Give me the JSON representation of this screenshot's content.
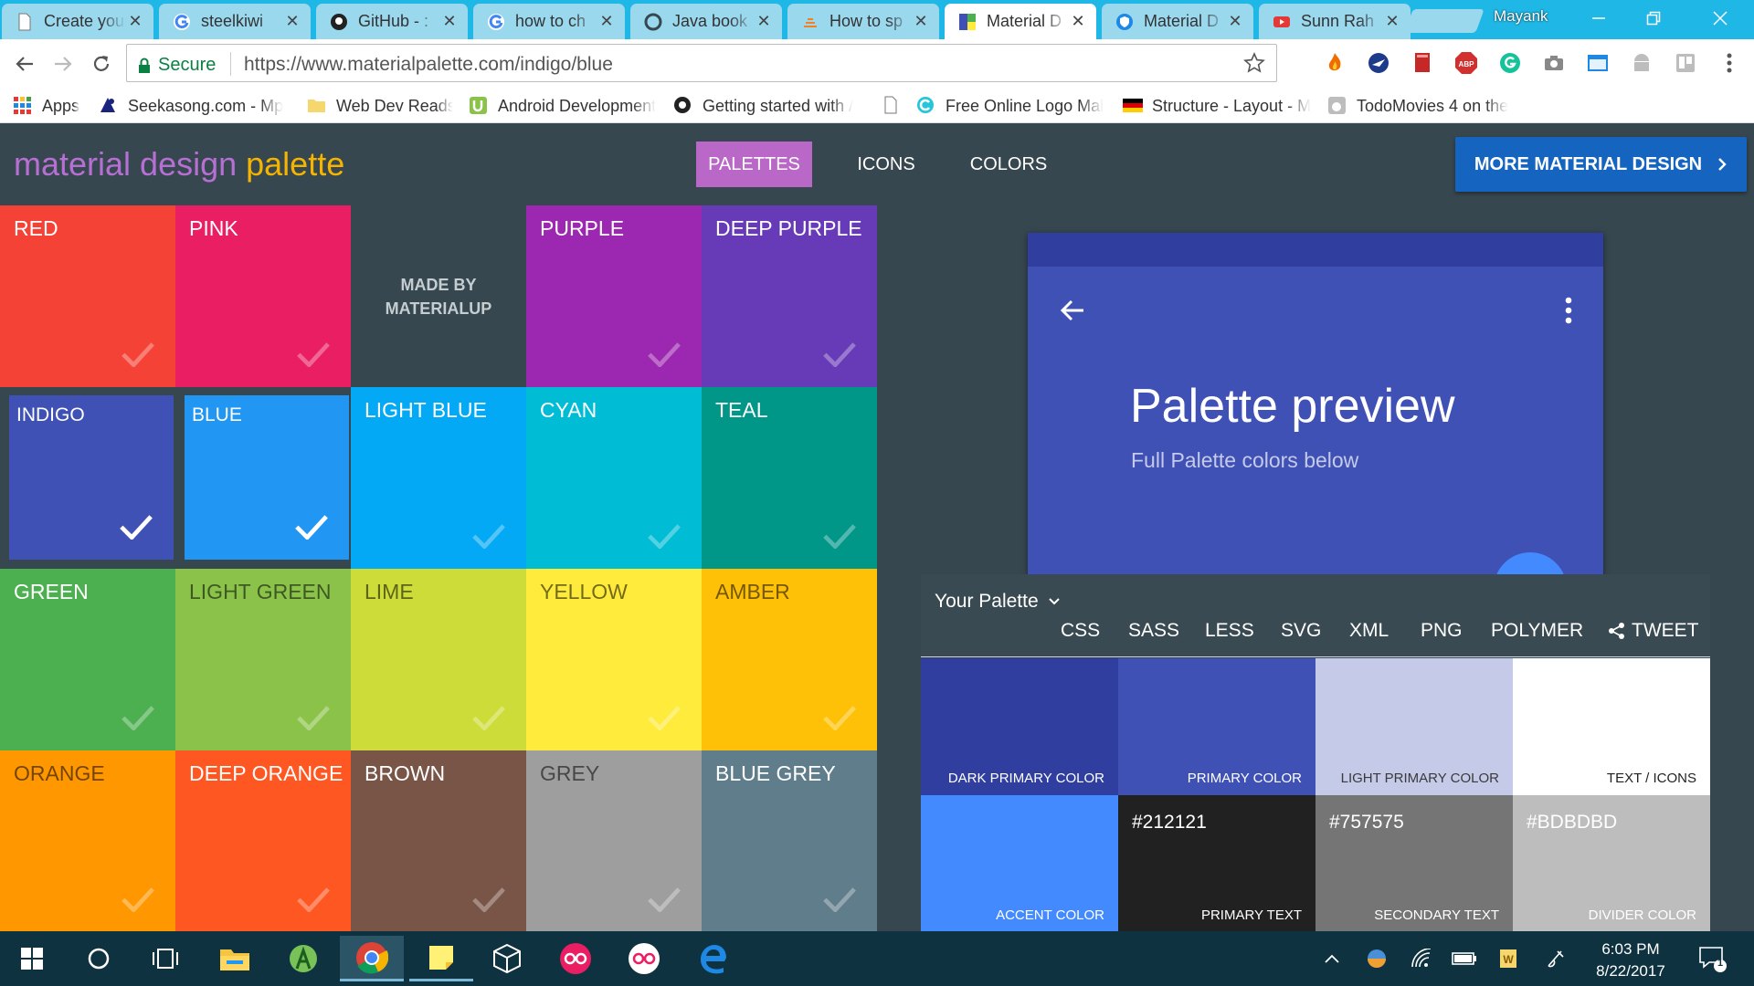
{
  "browser": {
    "tabs": [
      {
        "title": "Create your",
        "icon": "document-icon"
      },
      {
        "title": "steelkiwi",
        "icon": "google-icon"
      },
      {
        "title": "GitHub - :",
        "icon": "github-icon"
      },
      {
        "title": "how to ch",
        "icon": "google-icon"
      },
      {
        "title": "Java book",
        "icon": "circle-icon"
      },
      {
        "title": "How to sp",
        "icon": "stack-icon"
      },
      {
        "title": "Material D",
        "icon": "material-palette-icon"
      },
      {
        "title": "Material D",
        "icon": "shield-icon"
      },
      {
        "title": "Sunn Rah",
        "icon": "youtube-icon"
      }
    ],
    "active_tab": 6,
    "profile_name": "Mayank",
    "secure_label": "Secure",
    "url": "https://www.materialpalette.com/indigo/blue",
    "bookmarks": [
      {
        "label": "Apps",
        "icon": "apps-grid-icon"
      },
      {
        "label": "Seekasong.com - Mp",
        "icon": "seekasong-icon"
      },
      {
        "label": "Web Dev Reads",
        "icon": "folder-icon"
      },
      {
        "label": "Android Development",
        "icon": "udemy-icon"
      },
      {
        "label": "Getting started with /",
        "icon": "github-octocat-icon"
      },
      {
        "label": "",
        "icon": "blank-page-icon"
      },
      {
        "label": "Free Online Logo Mal",
        "icon": "logo-maker-icon"
      },
      {
        "label": "Structure - Layout - M",
        "icon": "german-flag-icon"
      },
      {
        "label": "TodoMovies 4 on the",
        "icon": "apple-icon"
      }
    ]
  },
  "site": {
    "logo_part1": "material design",
    "logo_part2": "palette",
    "nav": [
      "PALETTES",
      "ICONS",
      "COLORS"
    ],
    "more_button": "MORE MATERIAL DESIGN",
    "made_by": [
      "MADE BY",
      "MATERIALUP"
    ],
    "colors": [
      {
        "name": "RED",
        "hex": "#f44336",
        "selected": false,
        "dark_text": false
      },
      {
        "name": "PINK",
        "hex": "#e91e63",
        "selected": false,
        "dark_text": false
      },
      {
        "name": "",
        "hex": "#37474f",
        "selected": false,
        "dark_text": false
      },
      {
        "name": "PURPLE",
        "hex": "#9c27b0",
        "selected": false,
        "dark_text": false
      },
      {
        "name": "DEEP PURPLE",
        "hex": "#673ab7",
        "selected": false,
        "dark_text": false
      },
      {
        "name": "INDIGO",
        "hex": "#3f51b5",
        "selected": true,
        "dark_text": false
      },
      {
        "name": "BLUE",
        "hex": "#2196f3",
        "selected": true,
        "dark_text": false
      },
      {
        "name": "LIGHT BLUE",
        "hex": "#03a9f4",
        "selected": false,
        "dark_text": false
      },
      {
        "name": "CYAN",
        "hex": "#00bcd4",
        "selected": false,
        "dark_text": false
      },
      {
        "name": "TEAL",
        "hex": "#009688",
        "selected": false,
        "dark_text": false
      },
      {
        "name": "GREEN",
        "hex": "#4caf50",
        "selected": false,
        "dark_text": false
      },
      {
        "name": "LIGHT GREEN",
        "hex": "#8bc34a",
        "selected": false,
        "dark_text": true
      },
      {
        "name": "LIME",
        "hex": "#cddc39",
        "selected": false,
        "dark_text": true
      },
      {
        "name": "YELLOW",
        "hex": "#ffeb3b",
        "selected": false,
        "dark_text": true
      },
      {
        "name": "AMBER",
        "hex": "#ffc107",
        "selected": false,
        "dark_text": true
      },
      {
        "name": "ORANGE",
        "hex": "#ff9800",
        "selected": false,
        "dark_text": true
      },
      {
        "name": "DEEP ORANGE",
        "hex": "#ff5722",
        "selected": false,
        "dark_text": false
      },
      {
        "name": "BROWN",
        "hex": "#795548",
        "selected": false,
        "dark_text": false
      },
      {
        "name": "GREY",
        "hex": "#9e9e9e",
        "selected": false,
        "dark_text": true
      },
      {
        "name": "BLUE GREY",
        "hex": "#607d8b",
        "selected": false,
        "dark_text": false
      }
    ]
  },
  "preview": {
    "title": "Palette preview",
    "subtitle": "Full Palette colors below",
    "status_color": "#303f9f",
    "toolbar_color": "#3f51b5",
    "fab_color": "#448aff"
  },
  "palette_panel": {
    "title": "Your Palette",
    "export_options": [
      "CSS",
      "SASS",
      "LESS",
      "SVG",
      "XML",
      "PNG",
      "POLYMER",
      "TWEET"
    ],
    "swatches": [
      {
        "label": "DARK PRIMARY COLOR",
        "hex_text": "",
        "bg": "#303f9f",
        "fg": "#ffffff"
      },
      {
        "label": "PRIMARY COLOR",
        "hex_text": "",
        "bg": "#3f51b5",
        "fg": "#ffffff"
      },
      {
        "label": "LIGHT PRIMARY COLOR",
        "hex_text": "",
        "bg": "#c5cae9",
        "fg": "#3a3a3a"
      },
      {
        "label": "TEXT / ICONS",
        "hex_text": "",
        "bg": "#ffffff",
        "fg": "#222222"
      },
      {
        "label": "ACCENT COLOR",
        "hex_text": "",
        "bg": "#448aff",
        "fg": "#ffffff"
      },
      {
        "label": "PRIMARY TEXT",
        "hex_text": "#212121",
        "bg": "#212121",
        "fg": "#ffffff"
      },
      {
        "label": "SECONDARY TEXT",
        "hex_text": "#757575",
        "bg": "#757575",
        "fg": "#ffffff"
      },
      {
        "label": "DIVIDER COLOR",
        "hex_text": "#BDBDBD",
        "bg": "#bdbdbd",
        "fg": "#ffffff"
      }
    ]
  },
  "taskbar": {
    "time": "6:03 PM",
    "date": "8/22/2017",
    "notification_count": "1"
  }
}
